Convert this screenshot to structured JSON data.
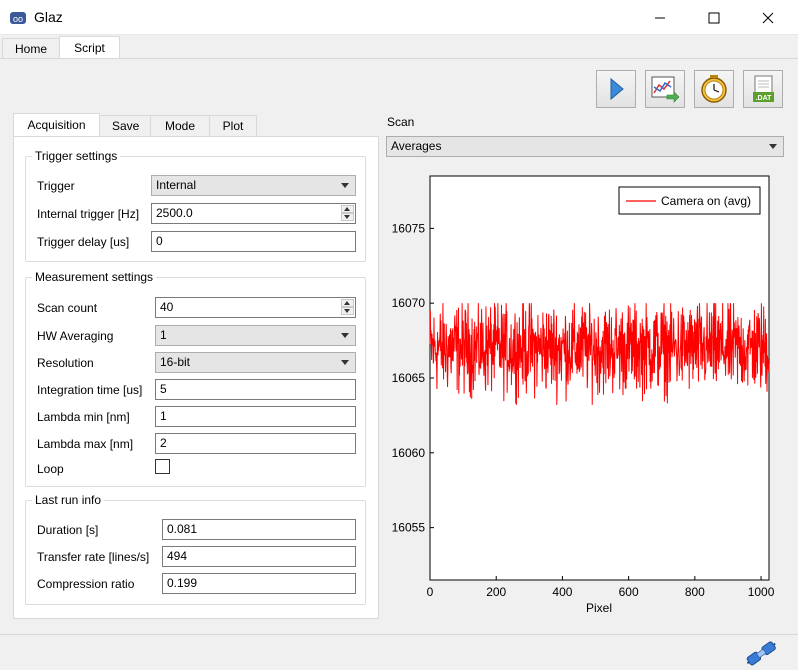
{
  "window": {
    "title": "Glaz"
  },
  "main_tabs": [
    {
      "label": "Home"
    },
    {
      "label": "Script"
    }
  ],
  "toolbar": {
    "buttons": [
      "play-icon",
      "chart-export-icon",
      "timer-icon",
      "dat-file-icon"
    ]
  },
  "sub_tabs": [
    {
      "label": "Acquisition"
    },
    {
      "label": "Save"
    },
    {
      "label": "Mode"
    },
    {
      "label": "Plot"
    }
  ],
  "trigger": {
    "title": "Trigger settings",
    "trigger_label": "Trigger",
    "trigger_value": "Internal",
    "internal_label": "Internal trigger [Hz]",
    "internal_value": "2500.0",
    "delay_label": "Trigger delay [us]",
    "delay_value": "0"
  },
  "measurement": {
    "title": "Measurement settings",
    "scan_count_label": "Scan count",
    "scan_count_value": "40",
    "hw_avg_label": "HW Averaging",
    "hw_avg_value": "1",
    "resolution_label": "Resolution",
    "resolution_value": "16-bit",
    "integration_label": "Integration time [us]",
    "integration_value": "5",
    "lambda_min_label": "Lambda min [nm]",
    "lambda_min_value": "1",
    "lambda_max_label": "Lambda max [nm]",
    "lambda_max_value": "2",
    "loop_label": "Loop",
    "loop_checked": false
  },
  "last_run": {
    "title": "Last run info",
    "duration_label": "Duration [s]",
    "duration_value": "0.081",
    "transfer_label": "Transfer rate [lines/s]",
    "transfer_value": "494",
    "compression_label": "Compression ratio",
    "compression_value": "0.199"
  },
  "scan": {
    "label": "Scan",
    "select_value": "Averages"
  },
  "chart_data": {
    "type": "line",
    "xlabel": "Pixel",
    "ylabel": "",
    "xlim": [
      0,
      1024
    ],
    "ylim": [
      16051.5,
      16078.5
    ],
    "x_ticks": [
      0,
      200,
      400,
      600,
      800,
      1000
    ],
    "y_ticks": [
      16055,
      16060,
      16065,
      16070,
      16075
    ],
    "legend_position": "top-right",
    "series": [
      {
        "name": "Camera on (avg)",
        "color": "#ff0000",
        "x_range": [
          0,
          1024
        ],
        "mean": 16067.0,
        "noise_range": [
          16063.2,
          16070.0
        ]
      }
    ]
  }
}
